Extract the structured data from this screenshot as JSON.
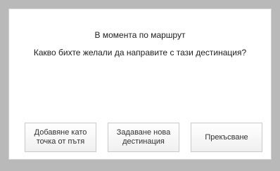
{
  "dialog": {
    "title": "В момента по маршрут",
    "question": "Какво бихте желали да направите с тази дестинация?",
    "buttons": {
      "add_waypoint": "Добавяне като\nточка от пътя",
      "new_destination": "Задаване нова\nдестинация",
      "cancel": "Прекъсване"
    }
  }
}
